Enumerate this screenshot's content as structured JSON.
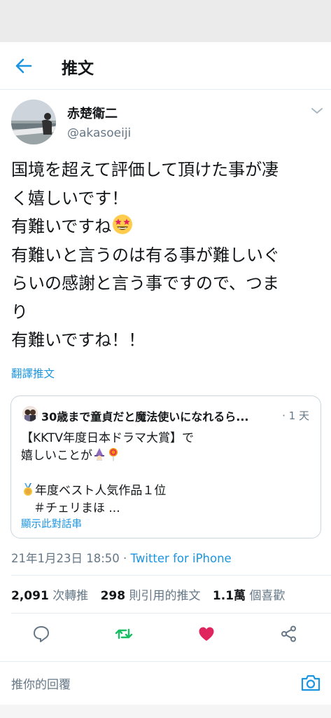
{
  "header": {
    "title": "推文",
    "back_icon": "arrow-left-icon"
  },
  "tweet": {
    "author_name": "赤楚衛二",
    "handle": "@akasoeiji",
    "lines": [
      "国境を超えて評価して頂けた事が凄",
      "く嬉しいです！",
      "有難いですね",
      "有難いと言うのは有る事が難しいぐ",
      "らいの感謝と言う事ですので、つま",
      "り",
      "有難いですね！！"
    ],
    "emoji": "star-struck-emoji",
    "translate_label": "翻譯推文"
  },
  "quote": {
    "author_name": "30歳まで童貞だと魔法使いになれるら...",
    "time": "· 1 天",
    "lines": [
      "【KKTV年度日本ドラマ大賞】で",
      "嬉しいことが",
      "",
      "年度ベスト人気作品１位",
      "＃チェリまほ ..."
    ],
    "thread_label": "顯示此對話串"
  },
  "meta": {
    "date": "21年1月23日 18:50 · ",
    "source": "Twitter for iPhone"
  },
  "stats": {
    "retweets_count": "2,091",
    "retweets_label": "次轉推",
    "quotes_count": "298",
    "quotes_label": "則引用的推文",
    "likes_count": "1.1萬",
    "likes_label": "個喜歡"
  },
  "actions": {
    "reply_icon": "comment-icon",
    "retweet_icon": "retweet-icon",
    "like_icon": "heart-icon",
    "share_icon": "share-icon"
  },
  "reply_bar": {
    "placeholder": "推你的回覆",
    "camera_icon": "camera-icon"
  },
  "colors": {
    "accent": "#1b95e0",
    "retweet_green": "#17bf63",
    "like_red": "#e0245e",
    "text": "#14171a",
    "muted": "#657786"
  }
}
